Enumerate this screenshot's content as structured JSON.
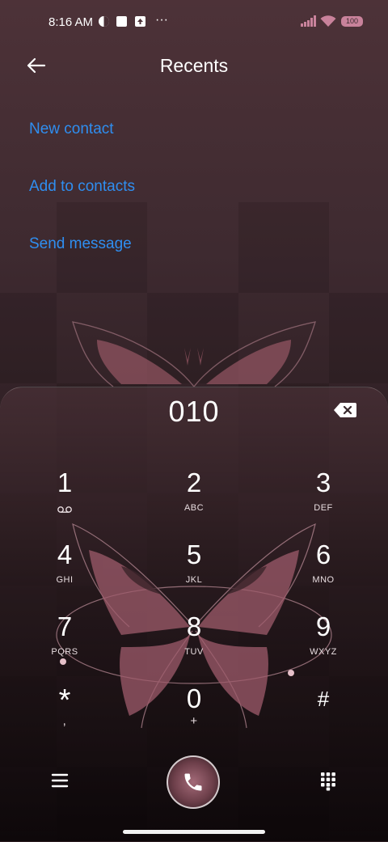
{
  "status_bar": {
    "time": "8:16 AM",
    "more": "···",
    "battery": "100"
  },
  "header": {
    "title": "Recents"
  },
  "actions": {
    "new_contact": "New contact",
    "add_to_contacts": "Add to contacts",
    "send_message": "Send message"
  },
  "dialer": {
    "entered_number": "010",
    "keys": [
      {
        "num": "1",
        "sub": "voicemail-icon"
      },
      {
        "num": "2",
        "sub": "ABC"
      },
      {
        "num": "3",
        "sub": "DEF"
      },
      {
        "num": "4",
        "sub": "GHI"
      },
      {
        "num": "5",
        "sub": "JKL"
      },
      {
        "num": "6",
        "sub": "MNO"
      },
      {
        "num": "7",
        "sub": "PQRS"
      },
      {
        "num": "8",
        "sub": "TUV"
      },
      {
        "num": "9",
        "sub": "WXYZ"
      },
      {
        "num": "*",
        "sub": ","
      },
      {
        "num": "0",
        "sub": "+"
      },
      {
        "num": "#",
        "sub": ""
      }
    ]
  },
  "colors": {
    "accent_link": "#2f8ef0",
    "call_button": "#8a5563",
    "butterfly": "#b06e7e"
  },
  "icons": {
    "back": "arrow-left-icon",
    "backspace": "backspace-icon",
    "menu": "menu-icon",
    "call": "phone-icon",
    "keypad": "keypad-icon"
  }
}
